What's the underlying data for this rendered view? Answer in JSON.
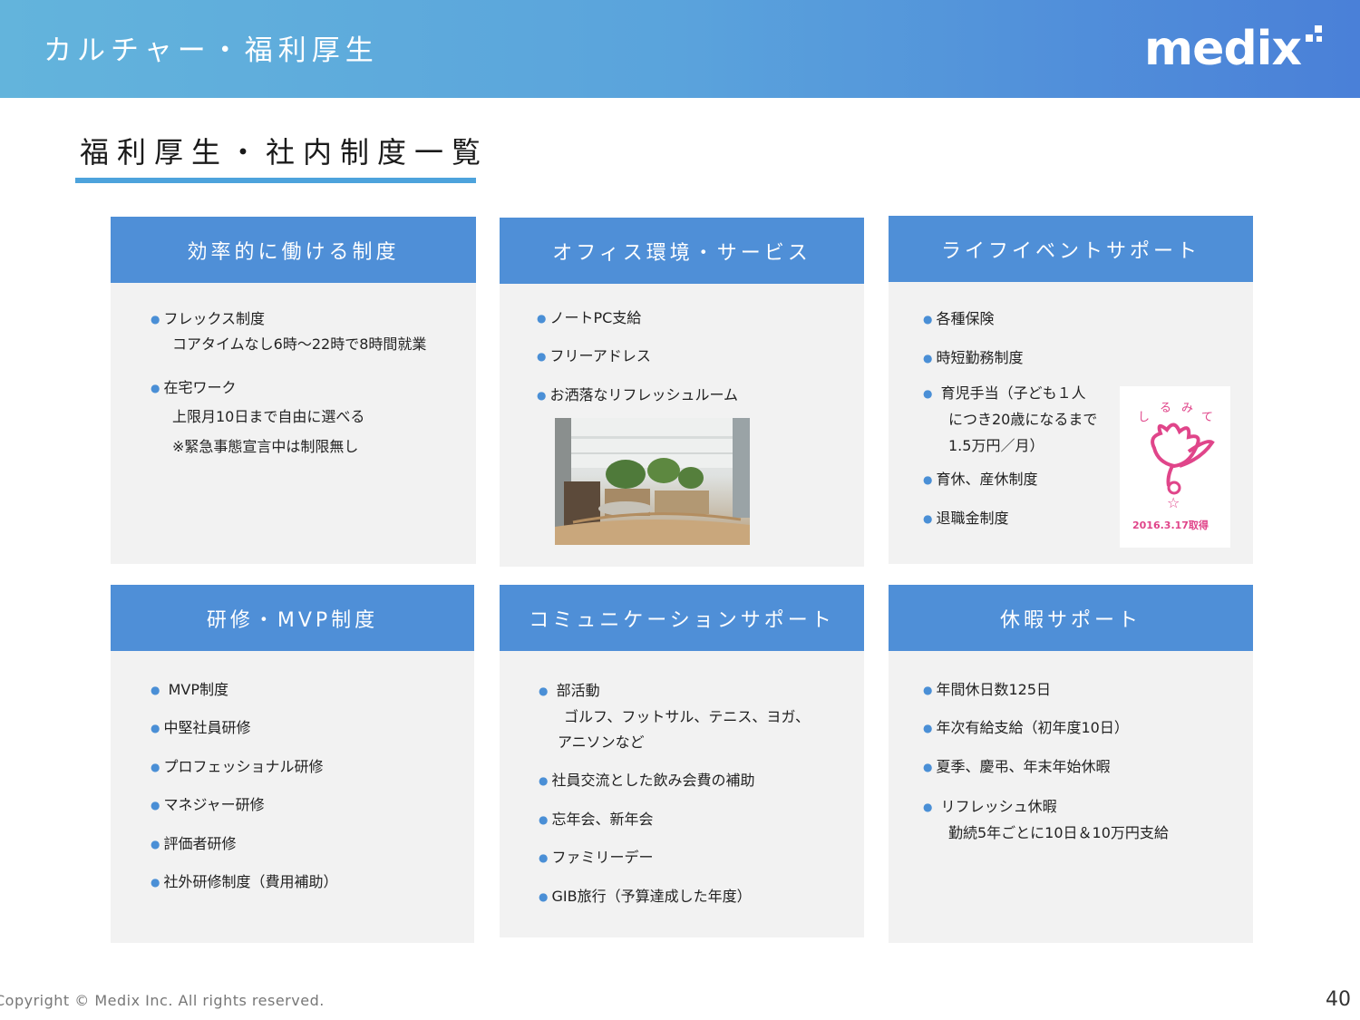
{
  "header": {
    "title": "カルチャー・福利厚生",
    "logo_text": "medix"
  },
  "section": {
    "title": "福利厚生・社内制度一覧"
  },
  "cards": {
    "efficient": {
      "title": "効率的に働ける制度",
      "items": [
        "フレックス制度",
        "在宅ワーク"
      ],
      "subs": [
        "コアタイムなし6時～22時で8時間就業",
        "上限月10日まで自由に選べる",
        "※緊急事態宣言中は制限無し"
      ]
    },
    "office": {
      "title": "オフィス環境・サービス",
      "items": [
        "ノートPC支給",
        "フリーアドレス",
        "お洒落なリフレッシュルーム"
      ]
    },
    "life": {
      "title": "ライフイベントサポート",
      "items": [
        "各種保険",
        "時短勤務制度",
        "育児手当（子ども１人",
        "育休、産休制度",
        "退職金制度"
      ],
      "subs": [
        "につき20歳になるまで",
        "1.5万円／月）"
      ],
      "badge_top": "くるみん",
      "badge_date": "2016.3.17取得"
    },
    "training": {
      "title": "研修・MVP制度",
      "items": [
        "MVP制度",
        "中堅社員研修",
        "プロフェッショナル研修",
        "マネジャー研修",
        "評価者研修",
        "社外研修制度（費用補助）"
      ]
    },
    "communication": {
      "title": "コミュニケーションサポート",
      "items": [
        "部活動",
        "社員交流とした飲み会費の補助",
        "忘年会、新年会",
        "ファミリーデー",
        "GIB旅行（予算達成した年度）"
      ],
      "subs": [
        "ゴルフ、フットサル、テニス、ヨガ、",
        "アニソンなど"
      ]
    },
    "holiday": {
      "title": "休暇サポート",
      "items": [
        "年間休日数125日",
        "年次有給支給（初年度10日）",
        "夏季、慶弔、年末年始休暇",
        "リフレッシュ休暇"
      ],
      "subs": [
        "勤続5年ごとに10日＆10万円支給"
      ]
    }
  },
  "footer": {
    "copyright": "Copyright © Medix Inc. All rights reserved.",
    "page": "40"
  },
  "colors": {
    "header_start": "#63b4dc",
    "header_end": "#4a80d8",
    "card_head": "#4f8fd7",
    "card_bg": "#f2f2f2",
    "bullet": "#4a8fd6",
    "badge_pink": "#e0458a"
  }
}
